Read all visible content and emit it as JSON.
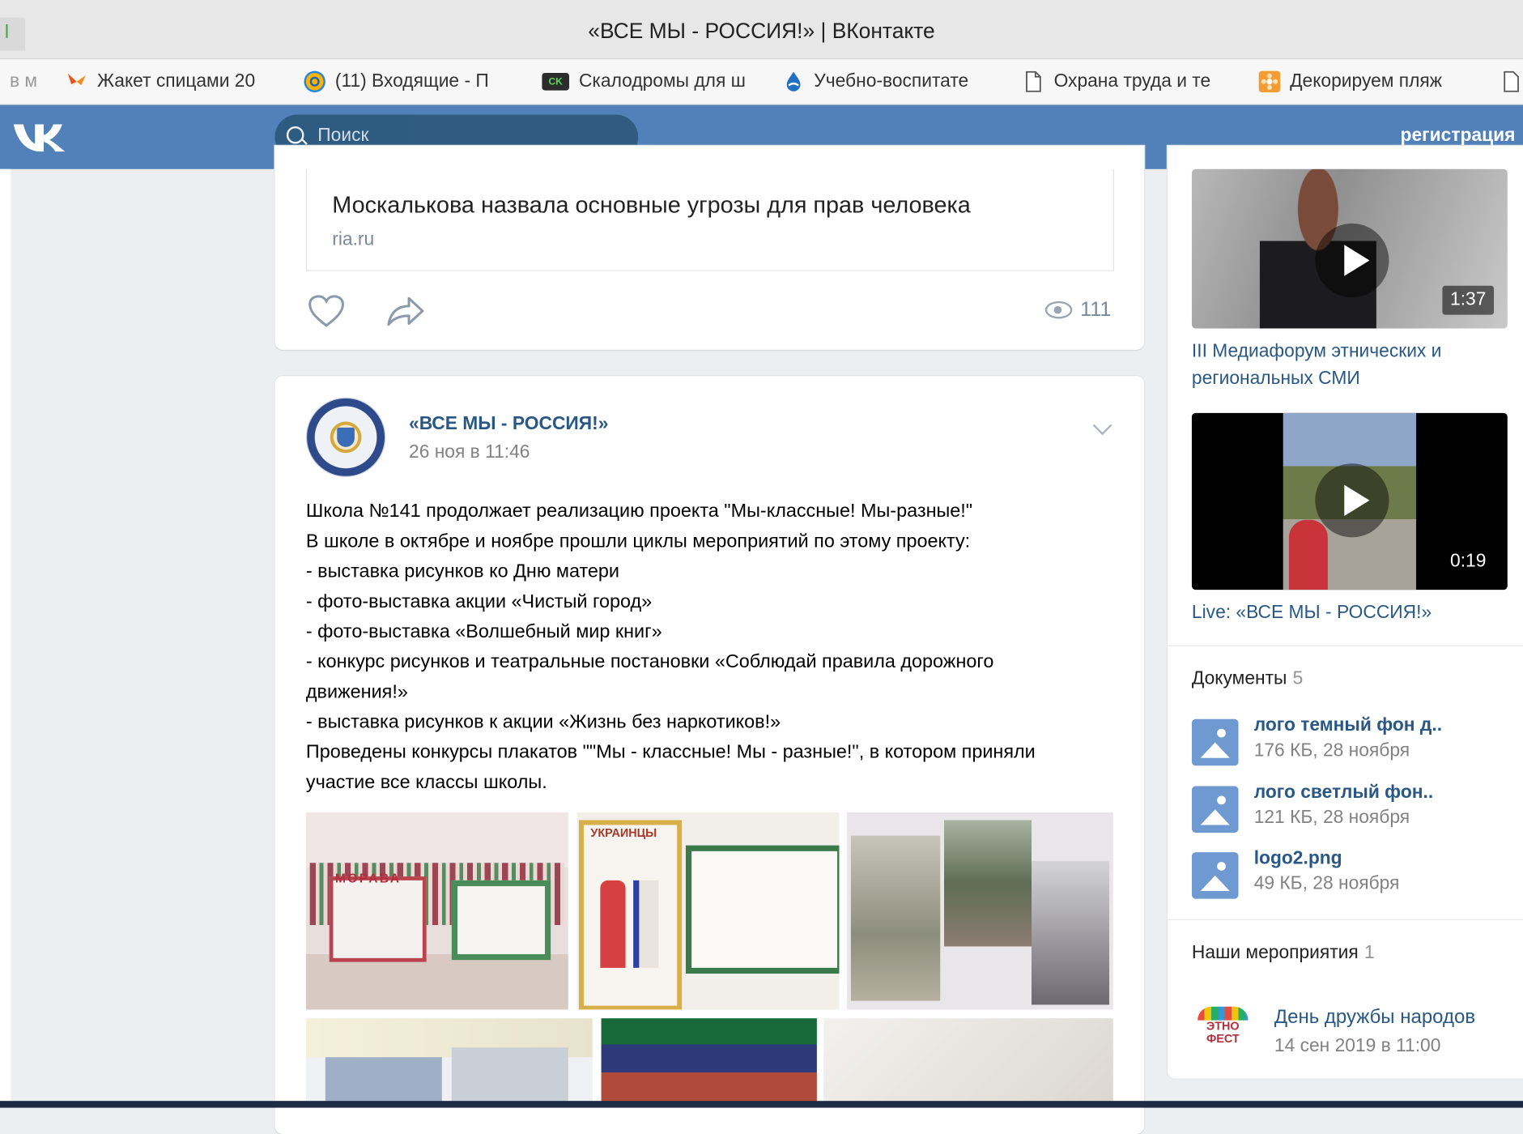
{
  "browser": {
    "window_title": "«ВСЕ МЫ - РОССИЯ!» | ВКонтакте",
    "bookmarks": [
      {
        "label": "в м",
        "icon": "none"
      },
      {
        "label": "Жакет спицами 20",
        "icon": "butterfly-icon"
      },
      {
        "label": "(11) Входящие - П",
        "icon": "mail-at-icon"
      },
      {
        "label": "Скалодромы для ш",
        "icon": "ck-logo-icon"
      },
      {
        "label": "Учебно-воспитате",
        "icon": "drop-globe-icon"
      },
      {
        "label": "Охрана труда и те",
        "icon": "page-icon"
      },
      {
        "label": "Декорируем пляж",
        "icon": "flower-icon"
      }
    ]
  },
  "vk": {
    "logo": "VK",
    "search_placeholder": "Поиск",
    "register_label": "регистрация"
  },
  "post_prev": {
    "link_title": "Москалькова назвала основные угрозы для прав человека",
    "link_domain": "ria.ru",
    "views": "111"
  },
  "post": {
    "author": "«ВСЕ МЫ - РОССИЯ!»",
    "date": "26 ноя в 11:46",
    "lines": [
      "Школа №141 продолжает реализацию проекта \"Мы-классные! Мы-разные!\"",
      "В школе в октябре и ноябре прошли циклы мероприятий по этому проекту:",
      "- выставка рисунков ко Дню матери",
      "- фото-выставка акции «Чистый город»",
      "- фото-выставка «Волшебный мир книг»",
      "- конкурс рисунков и театральные постановки «Соблюдай правила дорожного",
      "движения!»",
      "- выставка рисунков к акции «Жизнь без наркотиков!»",
      "Проведены конкурсы плакатов \"\"Мы - классные! Мы - разные!\", в котором приняли",
      "участие все классы школы."
    ],
    "photo_text": [
      "МОРАВА",
      "УКРАИНЦЫ"
    ]
  },
  "sidebar": {
    "videos": [
      {
        "title": "III Медиафорум этнических и региональных СМИ",
        "duration": "1:37"
      },
      {
        "title": "Live: «ВСЕ МЫ - РОССИЯ!»",
        "duration": "0:19"
      }
    ],
    "documents": {
      "heading": "Документы",
      "count": "5",
      "items": [
        {
          "name": "лого темный фон д..",
          "meta": "176 КБ, 28 ноября"
        },
        {
          "name": "лого светлый фон..",
          "meta": "121 КБ, 28 ноября"
        },
        {
          "name": "logo2.png",
          "meta": "49 КБ, 28 ноября"
        }
      ]
    },
    "events": {
      "heading": "Наши мероприятия",
      "count": "1",
      "item": {
        "name": "День дружбы народов",
        "date": "14 сен 2019 в 11:00",
        "logo_text": "ЭТНО ФЕСТ"
      }
    }
  },
  "colors": {
    "vk_header": "#5181b8",
    "link": "#2a5885",
    "muted": "#828282",
    "page_bg": "#edeef0"
  }
}
